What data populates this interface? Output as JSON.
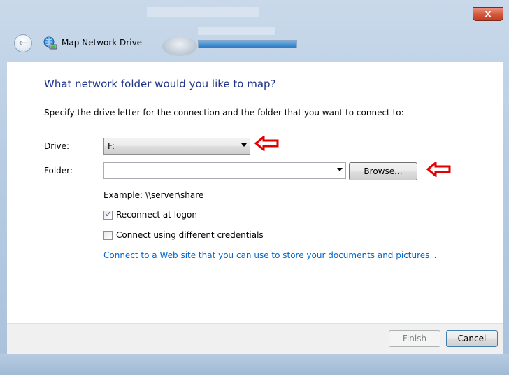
{
  "window": {
    "title": "Map Network Drive",
    "close_symbol": "x",
    "back_icon": "back-arrow-icon",
    "title_icon": "network-drive-icon"
  },
  "page": {
    "heading": "What network folder would you like to map?",
    "instruction": "Specify the drive letter for the connection and the folder that you want to connect to:"
  },
  "form": {
    "drive_label": "Drive:",
    "drive_value": "F:",
    "folder_label": "Folder:",
    "folder_value": "",
    "browse_label": "Browse...",
    "example": "Example: \\\\server\\share",
    "reconnect_label": "Reconnect at logon",
    "reconnect_checked": true,
    "credentials_label": "Connect using different credentials",
    "credentials_checked": false,
    "link_text": "Connect to a Web site that you can use to store your documents and pictures",
    "link_suffix": "."
  },
  "footer": {
    "finish_label": "Finish",
    "cancel_label": "Cancel"
  },
  "annotation": {
    "arrow_color": "#e00000"
  }
}
